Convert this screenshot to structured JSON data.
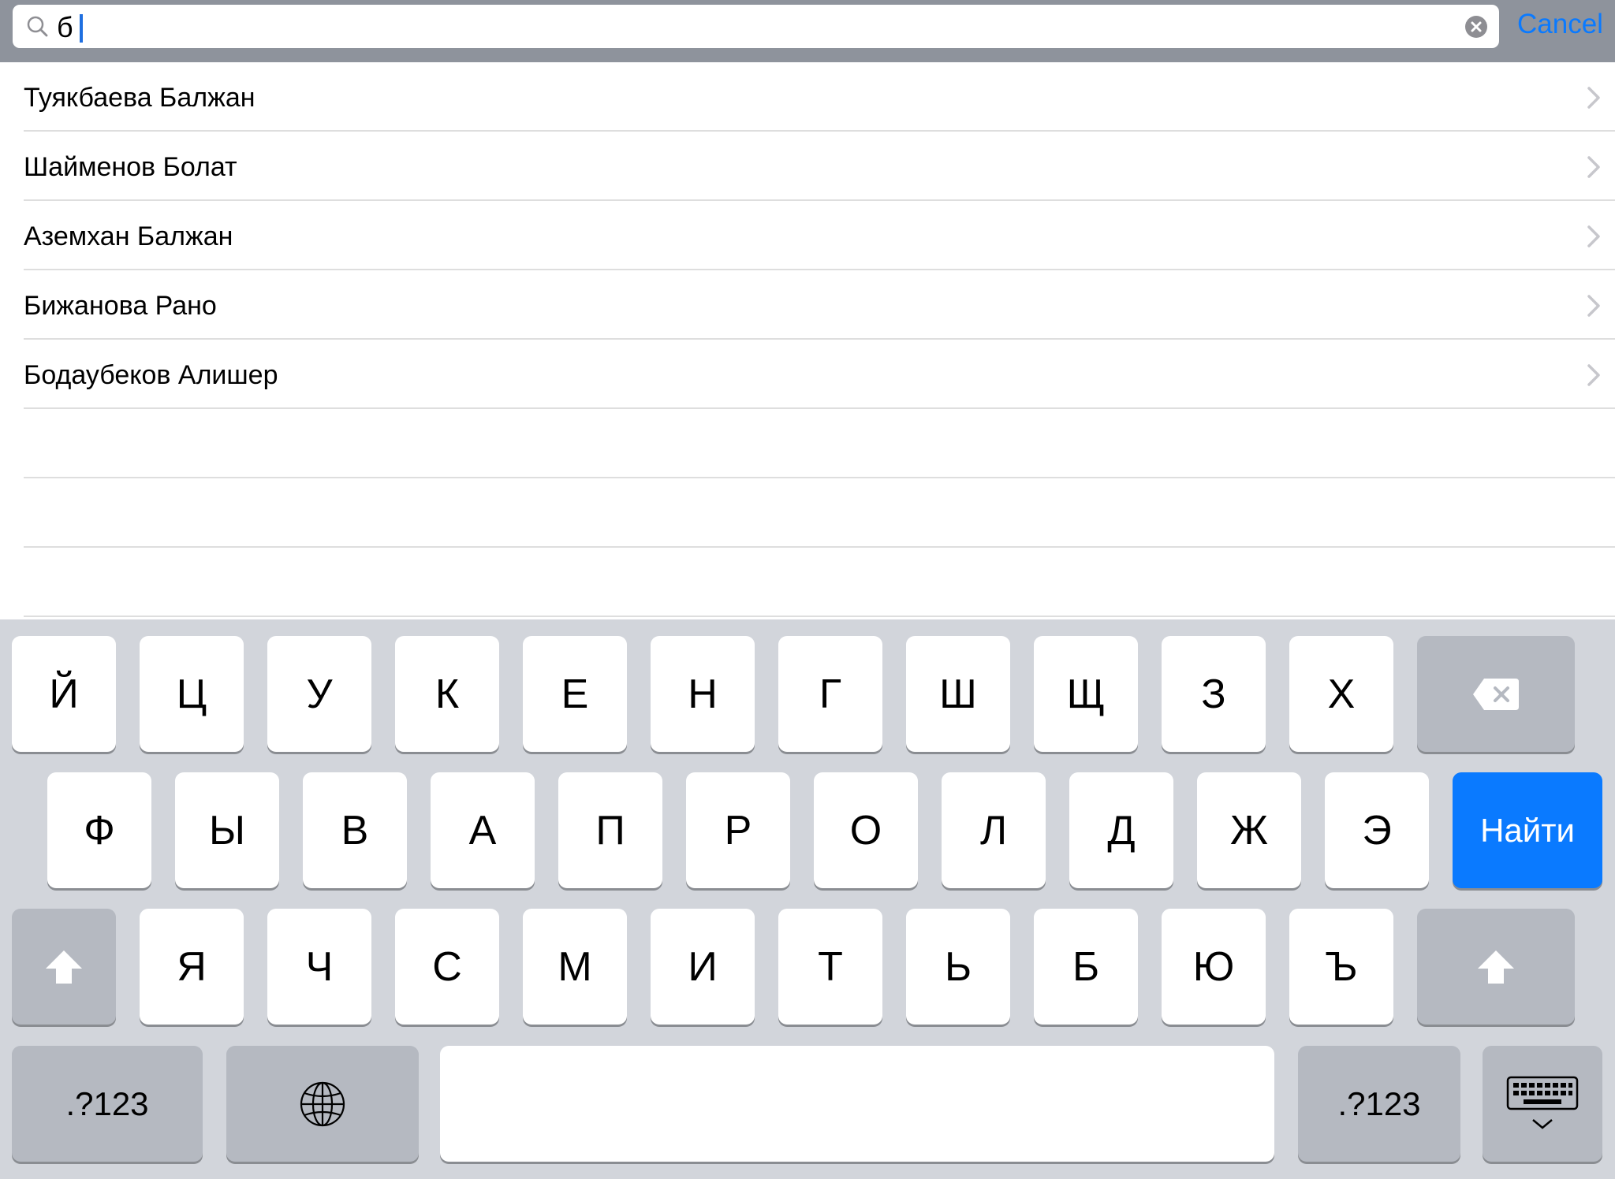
{
  "search": {
    "query": "б",
    "cancel_label": "Cancel"
  },
  "results": [
    {
      "label": "Туякбаева Балжан"
    },
    {
      "label": "Шайменов Болат"
    },
    {
      "label": "Аземхан Балжан"
    },
    {
      "label": "Бижанова Рано"
    },
    {
      "label": "Бодаубеков Алишер"
    }
  ],
  "keyboard": {
    "row1": [
      "Й",
      "Ц",
      "У",
      "К",
      "Е",
      "Н",
      "Г",
      "Ш",
      "Щ",
      "З",
      "Х"
    ],
    "row2": [
      "Ф",
      "Ы",
      "В",
      "А",
      "П",
      "Р",
      "О",
      "Л",
      "Д",
      "Ж",
      "Э"
    ],
    "row3": [
      "Я",
      "Ч",
      "С",
      "М",
      "И",
      "Т",
      "Ь",
      "Б",
      "Ю",
      "Ъ"
    ],
    "search_key": "Найти",
    "numbers_key": ".?123"
  },
  "colors": {
    "accent": "#0a7aff",
    "search_bar_bg": "#8e939c",
    "keyboard_bg": "#d2d5db"
  },
  "icons": {
    "search": "search-icon",
    "clear": "clear-icon",
    "chevron": "chevron-right-icon",
    "backspace": "backspace-icon",
    "shift": "shift-icon",
    "globe": "globe-icon",
    "hide_keyboard": "hide-keyboard-icon"
  }
}
